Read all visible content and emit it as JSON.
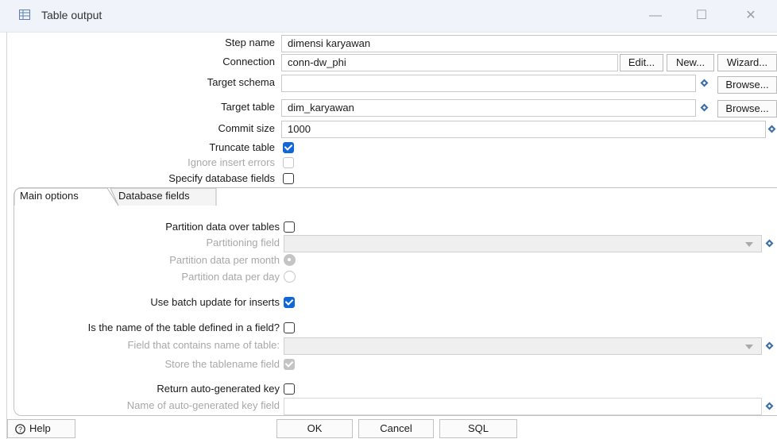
{
  "window": {
    "title": "Table output",
    "minimize": "—",
    "maximize": "☐",
    "close": "✕"
  },
  "fields": {
    "step_name_label": "Step name",
    "step_name_value": "dimensi karyawan",
    "connection_label": "Connection",
    "connection_value": "conn-dw_phi",
    "edit_label": "Edit...",
    "new_label": "New...",
    "wizard_label": "Wizard...",
    "target_schema_label": "Target schema",
    "target_schema_value": "",
    "browse_label": "Browse...",
    "target_table_label": "Target table",
    "target_table_value": "dim_karyawan",
    "commit_size_label": "Commit size",
    "commit_size_value": "1000",
    "truncate_label": "Truncate table",
    "ignore_errors_label": "Ignore insert errors",
    "specify_fields_label": "Specify database fields"
  },
  "tabs": [
    {
      "label": "Main options"
    },
    {
      "label": "Database fields"
    }
  ],
  "main_options": {
    "partition_label": "Partition data over tables",
    "partitioning_field_label": "Partitioning field",
    "per_month_label": "Partition data per month",
    "per_day_label": "Partition data per day",
    "batch_label": "Use batch update for inserts",
    "table_in_field_label": "Is the name of the table defined in a field?",
    "field_table_label": "Field that contains name of table:",
    "store_tablename_label": "Store the tablename field",
    "return_key_label": "Return auto-generated key",
    "key_field_label": "Name of auto-generated key field"
  },
  "footer": {
    "help_label": "Help",
    "ok_label": "OK",
    "cancel_label": "Cancel",
    "sql_label": "SQL"
  },
  "colors": {
    "accent": "#1167d6",
    "variable_icon": "#3c6fa8"
  }
}
